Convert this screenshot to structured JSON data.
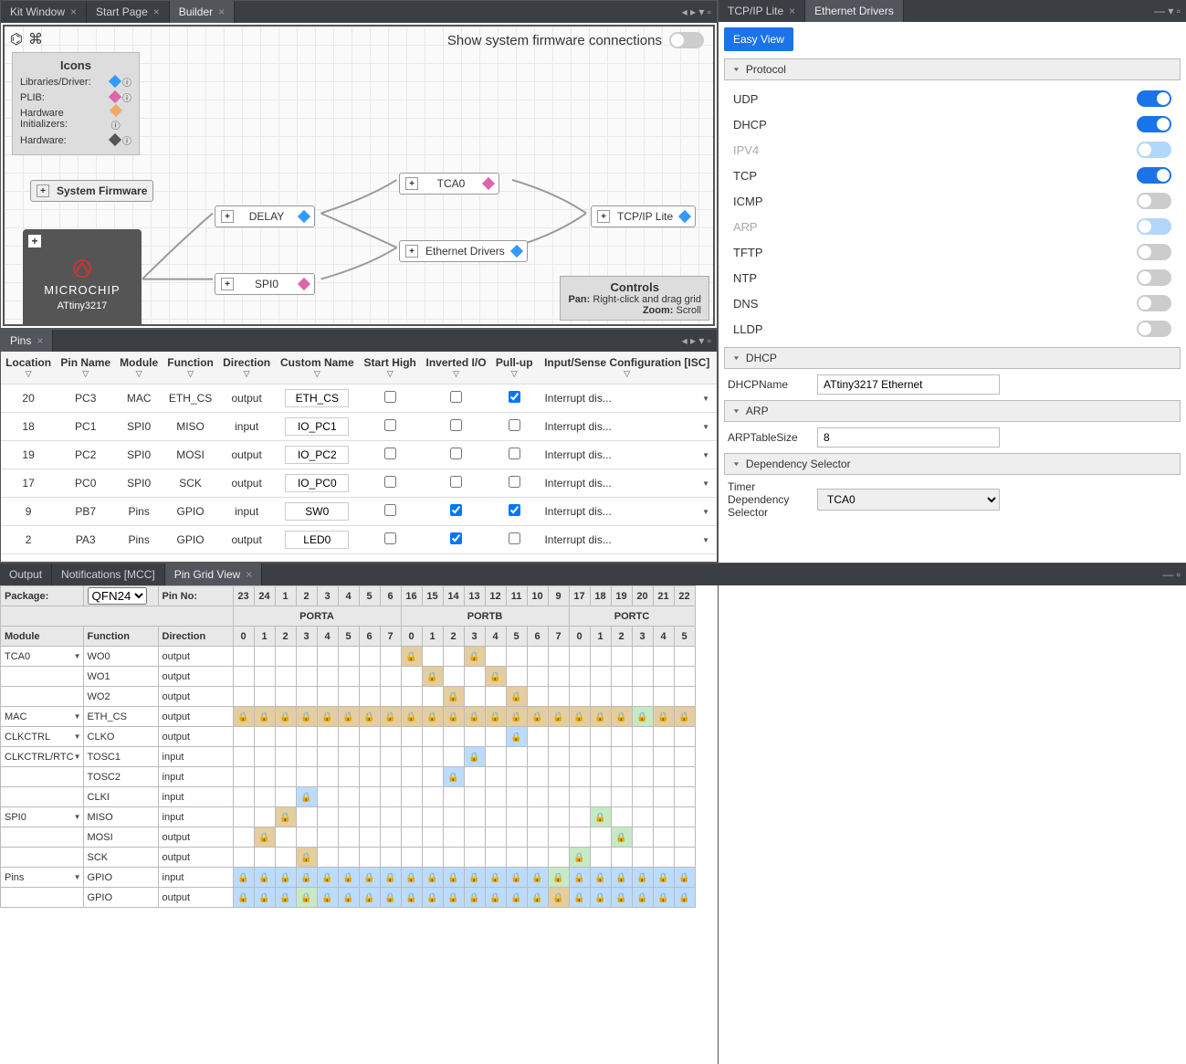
{
  "tabs_top": [
    "Kit Window",
    "Start Page",
    "Builder"
  ],
  "tabs_right": [
    "TCP/IP Lite",
    "Ethernet Drivers"
  ],
  "canvas": {
    "toggle_label": "Show system firmware connections",
    "icons_title": "Icons",
    "icons_rows": [
      {
        "label": "Libraries/Driver:",
        "color": "d-blue"
      },
      {
        "label": "PLIB:",
        "color": "d-pink"
      },
      {
        "label": "Hardware Initializers:",
        "color": "d-orange"
      },
      {
        "label": "Hardware:",
        "color": "d-grey"
      }
    ],
    "sys_firmware": "System Firmware",
    "chip_vendor": "MICROCHIP",
    "chip_name": "ATtiny3217",
    "nodes": {
      "delay": "DELAY",
      "spi0": "SPI0",
      "tca0": "TCA0",
      "eth": "Ethernet Drivers",
      "tcpip": "TCP/IP Lite"
    },
    "controls": {
      "title": "Controls",
      "pan_k": "Pan:",
      "pan_v": "Right-click and drag grid",
      "zoom_k": "Zoom:",
      "zoom_v": "Scroll"
    }
  },
  "config": {
    "easy": "Easy View",
    "sections": {
      "protocol": "Protocol",
      "dhcp": "DHCP",
      "arp": "ARP",
      "dep": "Dependency Selector"
    },
    "protocols": [
      {
        "name": "UDP",
        "state": "on"
      },
      {
        "name": "DHCP",
        "state": "on"
      },
      {
        "name": "IPV4",
        "state": "partial"
      },
      {
        "name": "TCP",
        "state": "on"
      },
      {
        "name": "ICMP",
        "state": "off"
      },
      {
        "name": "ARP",
        "state": "partial"
      },
      {
        "name": "TFTP",
        "state": "off"
      },
      {
        "name": "NTP",
        "state": "off"
      },
      {
        "name": "DNS",
        "state": "off"
      },
      {
        "name": "LLDP",
        "state": "off"
      }
    ],
    "dhcp_name_label": "DHCPName",
    "dhcp_name_value": "ATtiny3217 Ethernet",
    "arp_size_label": "ARPTableSize",
    "arp_size_value": "8",
    "timer_label": "Timer Dependency Selector",
    "timer_value": "TCA0"
  },
  "pins": {
    "title": "Pins",
    "headers": [
      "Location",
      "Pin Name",
      "Module",
      "Function",
      "Direction",
      "Custom Name",
      "Start High",
      "Inverted I/O",
      "Pull-up",
      "Input/Sense Configuration [ISC]"
    ],
    "rows": [
      {
        "loc": "20",
        "name": "PC3",
        "mod": "MAC",
        "fn": "ETH_CS",
        "dir": "output",
        "cname": "ETH_CS",
        "sh": false,
        "inv": false,
        "pu": true,
        "isc": "Interrupt dis..."
      },
      {
        "loc": "18",
        "name": "PC1",
        "mod": "SPI0",
        "fn": "MISO",
        "dir": "input",
        "cname": "IO_PC1",
        "sh": false,
        "inv": false,
        "pu": false,
        "isc": "Interrupt dis..."
      },
      {
        "loc": "19",
        "name": "PC2",
        "mod": "SPI0",
        "fn": "MOSI",
        "dir": "output",
        "cname": "IO_PC2",
        "sh": false,
        "inv": false,
        "pu": false,
        "isc": "Interrupt dis..."
      },
      {
        "loc": "17",
        "name": "PC0",
        "mod": "SPI0",
        "fn": "SCK",
        "dir": "output",
        "cname": "IO_PC0",
        "sh": false,
        "inv": false,
        "pu": false,
        "isc": "Interrupt dis..."
      },
      {
        "loc": "9",
        "name": "PB7",
        "mod": "Pins",
        "fn": "GPIO",
        "dir": "input",
        "cname": "SW0",
        "sh": false,
        "inv": true,
        "pu": true,
        "isc": "Interrupt dis..."
      },
      {
        "loc": "2",
        "name": "PA3",
        "mod": "Pins",
        "fn": "GPIO",
        "dir": "output",
        "cname": "LED0",
        "sh": false,
        "inv": true,
        "pu": false,
        "isc": "Interrupt dis..."
      }
    ]
  },
  "bottom_tabs": [
    "Output",
    "Notifications [MCC]",
    "Pin Grid View"
  ],
  "grid": {
    "pkg_label": "Package:",
    "pkg_value": "QFN24",
    "pinno_label": "Pin No:",
    "pinno": [
      "23",
      "24",
      "1",
      "2",
      "3",
      "4",
      "5",
      "6",
      "16",
      "15",
      "14",
      "13",
      "12",
      "11",
      "10",
      "9",
      "17",
      "18",
      "19",
      "20",
      "21",
      "22"
    ],
    "ports": [
      {
        "name": "PORTA",
        "span": 8
      },
      {
        "name": "PORTB",
        "span": 8
      },
      {
        "name": "PORTC",
        "span": 6
      }
    ],
    "portnums": [
      "0",
      "1",
      "2",
      "3",
      "4",
      "5",
      "6",
      "7",
      "0",
      "1",
      "2",
      "3",
      "4",
      "5",
      "6",
      "7",
      "0",
      "1",
      "2",
      "3",
      "4",
      "5"
    ],
    "col_headers": [
      "Module",
      "Function",
      "Direction"
    ],
    "rows": [
      {
        "mod": "TCA0",
        "first": true,
        "fn": "WO0",
        "dir": "output",
        "cells": {
          "8": "tan",
          "11": "tan"
        }
      },
      {
        "mod": "",
        "fn": "WO1",
        "dir": "output",
        "cells": {
          "9": "tan",
          "12": "tan"
        }
      },
      {
        "mod": "",
        "fn": "WO2",
        "dir": "output",
        "cells": {
          "10": "tan",
          "13": "tan"
        }
      },
      {
        "mod": "MAC",
        "first": true,
        "fn": "ETH_CS",
        "dir": "output",
        "cells": {
          "0": "tan",
          "1": "tan",
          "2": "tan",
          "3": "tan",
          "4": "tan",
          "5": "tan",
          "6": "tan",
          "7": "tan",
          "8": "tan",
          "9": "tan",
          "10": "tan",
          "11": "tan",
          "12": "tan",
          "13": "tan",
          "14": "tan",
          "15": "tan",
          "16": "tan",
          "17": "tan",
          "18": "tan",
          "19": "green",
          "20": "tan",
          "21": "tan"
        }
      },
      {
        "mod": "CLKCTRL",
        "first": true,
        "fn": "CLKO",
        "dir": "output",
        "cells": {
          "13": "blue"
        }
      },
      {
        "mod": "CLKCTRL/RTC",
        "first": true,
        "fn": "TOSC1",
        "dir": "input",
        "cells": {
          "11": "blue"
        }
      },
      {
        "mod": "",
        "fn": "TOSC2",
        "dir": "input",
        "cells": {
          "10": "blue"
        }
      },
      {
        "mod": "",
        "fn": "CLKI",
        "dir": "input",
        "cells": {
          "3": "blue"
        }
      },
      {
        "mod": "SPI0",
        "first": true,
        "fn": "MISO",
        "dir": "input",
        "cells": {
          "2": "tan",
          "17": "green"
        }
      },
      {
        "mod": "",
        "fn": "MOSI",
        "dir": "output",
        "cells": {
          "1": "tan",
          "18": "green"
        }
      },
      {
        "mod": "",
        "fn": "SCK",
        "dir": "output",
        "cells": {
          "3": "tan",
          "16": "green"
        }
      },
      {
        "mod": "Pins",
        "first": true,
        "fn": "GPIO",
        "dir": "input",
        "cells": {
          "0": "blue",
          "1": "blue",
          "2": "blue",
          "3": "blue",
          "4": "blue",
          "5": "blue",
          "6": "blue",
          "7": "blue",
          "8": "blue",
          "9": "blue",
          "10": "blue",
          "11": "blue",
          "12": "blue",
          "13": "blue",
          "14": "blue",
          "15": "green",
          "16": "blue",
          "17": "blue",
          "18": "blue",
          "19": "blue",
          "20": "blue",
          "21": "blue"
        }
      },
      {
        "mod": "",
        "fn": "GPIO",
        "dir": "output",
        "cells": {
          "0": "blue",
          "1": "blue",
          "2": "blue",
          "3": "green",
          "4": "blue",
          "5": "blue",
          "6": "blue",
          "7": "blue",
          "8": "blue",
          "9": "blue",
          "10": "blue",
          "11": "blue",
          "12": "blue",
          "13": "blue",
          "14": "blue",
          "15": "tan",
          "16": "blue",
          "17": "blue",
          "18": "blue",
          "19": "blue",
          "20": "blue",
          "21": "blue"
        }
      }
    ]
  }
}
